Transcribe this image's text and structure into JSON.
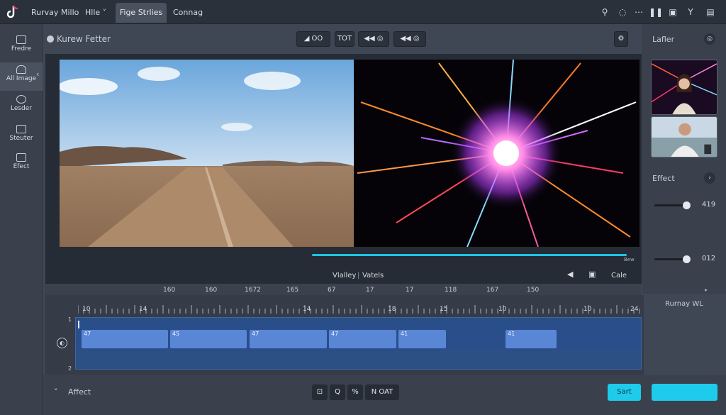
{
  "topbar": {
    "menu": [
      "Rurvay",
      "Millo",
      "Hlle ˅"
    ],
    "tabs": [
      "Fige Strlies",
      "Connag"
    ],
    "icons": [
      "wrench-icon",
      "refresh-icon",
      "ellipsis-icon",
      "pause-icon",
      "square-icon",
      "chevron-icon",
      "grid-icon"
    ]
  },
  "sidebar": {
    "items": [
      {
        "label": "Fredre",
        "icon": "image-plus-icon"
      },
      {
        "label": "All Image",
        "icon": "cloud-icon"
      },
      {
        "label": "Lesder",
        "icon": "music-icon"
      },
      {
        "label": "Steuter",
        "icon": "folder-icon"
      },
      {
        "label": "Efect",
        "icon": "effect-icon"
      }
    ]
  },
  "panel": {
    "title": "Kurew Fetter",
    "toolbar": [
      "◢  OO",
      "TOT",
      "◀◀  ◎",
      "◀◀  ◎"
    ],
    "progress": 1.0,
    "labels": [
      "Vlalley",
      "Vatels"
    ],
    "cale_label": "Cale",
    "progress_end_label": "Bew"
  },
  "right": {
    "title": "Lafler",
    "effect_label": "Effect",
    "sliders": [
      {
        "value": "419",
        "level": 0.82
      },
      {
        "value": "012",
        "level": 0.82
      }
    ],
    "timeline_title": "Rurnay WL"
  },
  "ruler": {
    "ticks": [
      "160",
      "160",
      "1672",
      "165",
      "67",
      "17",
      "17",
      "118",
      "167",
      "150"
    ]
  },
  "timeline": {
    "scale": [
      "10",
      "14",
      "14",
      "18",
      "15",
      "10",
      "10",
      "24"
    ],
    "lane_labels": [
      "1",
      "2"
    ],
    "clips": [
      {
        "label": "47"
      },
      {
        "label": "45"
      },
      {
        "label": "47"
      },
      {
        "label": "47"
      },
      {
        "label": "41"
      },
      {
        "label": "41"
      }
    ]
  },
  "bottom": {
    "affect_label": "Affect",
    "buttons": [
      "⊡",
      "Q",
      "%",
      "N  OAT"
    ],
    "start_label": "Sart",
    "cta_label": ""
  }
}
